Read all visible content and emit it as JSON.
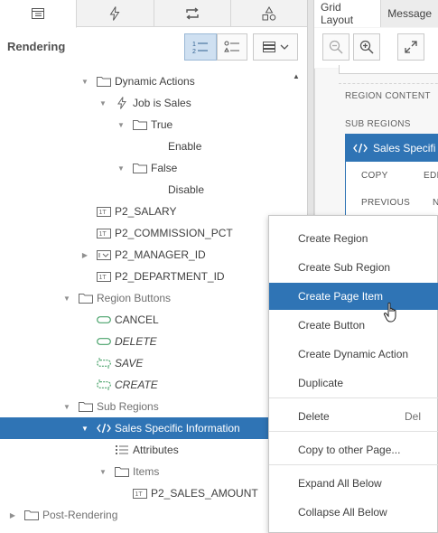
{
  "left_panel": {
    "tabs": [
      {
        "name": "tab-rendering",
        "icon": "tree-icon"
      },
      {
        "name": "tab-dynamic-actions",
        "icon": "lightning-icon"
      },
      {
        "name": "tab-processing",
        "icon": "loop-icon"
      },
      {
        "name": "tab-shared-components",
        "icon": "shapes-icon"
      }
    ],
    "title": "Rendering",
    "tree": [
      {
        "label": "Dynamic Actions",
        "icon": "folder-icon",
        "toggle": "open",
        "indent": 4
      },
      {
        "label": "Job is Sales",
        "icon": "lightning-icon",
        "toggle": "open",
        "indent": 5
      },
      {
        "label": "True",
        "icon": "folder-icon",
        "toggle": "open",
        "indent": 6
      },
      {
        "label": "Enable",
        "icon": "",
        "toggle": "",
        "indent": 8
      },
      {
        "label": "False",
        "icon": "folder-icon",
        "toggle": "open",
        "indent": 6
      },
      {
        "label": "Disable",
        "icon": "",
        "toggle": "",
        "indent": 8
      },
      {
        "label": "P2_SALARY",
        "icon": "text-field-icon",
        "toggle": "",
        "indent": 4
      },
      {
        "label": "P2_COMMISSION_PCT",
        "icon": "text-field-icon",
        "toggle": "",
        "indent": 4
      },
      {
        "label": "P2_MANAGER_ID",
        "icon": "select-list-icon",
        "toggle": "closed",
        "indent": 4
      },
      {
        "label": "P2_DEPARTMENT_ID",
        "icon": "text-field-icon",
        "toggle": "",
        "indent": 4
      },
      {
        "label": "Region Buttons",
        "icon": "folder-icon",
        "toggle": "open",
        "indent": 3,
        "gray": true
      },
      {
        "label": "CANCEL",
        "icon": "button-icon",
        "toggle": "",
        "indent": 4
      },
      {
        "label": "DELETE",
        "icon": "button-icon",
        "toggle": "",
        "indent": 4,
        "italic": true
      },
      {
        "label": "SAVE",
        "icon": "button-conditional-icon",
        "toggle": "",
        "indent": 4,
        "italic": true
      },
      {
        "label": "CREATE",
        "icon": "button-conditional-icon",
        "toggle": "",
        "indent": 4,
        "italic": true
      },
      {
        "label": "Sub Regions",
        "icon": "folder-icon",
        "toggle": "open",
        "indent": 3,
        "gray": true
      },
      {
        "label": "Sales Specific Information",
        "icon": "code-icon",
        "toggle": "open",
        "indent": 4,
        "selected": true
      },
      {
        "label": "Attributes",
        "icon": "list-icon",
        "toggle": "",
        "indent": 5
      },
      {
        "label": "Items",
        "icon": "folder-icon",
        "toggle": "open",
        "indent": 5,
        "gray": true
      },
      {
        "label": "P2_SALES_AMOUNT",
        "icon": "text-field-icon",
        "toggle": "",
        "indent": 6
      },
      {
        "label": "Post-Rendering",
        "icon": "folder-icon",
        "toggle": "closed",
        "indent": 0,
        "gray": true
      }
    ]
  },
  "right_panel": {
    "tabs": [
      "Grid Layout",
      "Message"
    ],
    "labels": {
      "region_content": "REGION CONTENT",
      "sub_regions": "SUB REGIONS",
      "sub_region_title": "Sales Specifi",
      "copy": "COPY",
      "edit": "EDI",
      "previous": "PREVIOUS",
      "next": "N"
    }
  },
  "context_menu": {
    "items": [
      {
        "label": "Create Region",
        "shortcut": ""
      },
      {
        "label": "Create Sub Region",
        "shortcut": ""
      },
      {
        "label": "Create Page Item",
        "shortcut": "",
        "highlighted": true
      },
      {
        "label": "Create Button",
        "shortcut": ""
      },
      {
        "label": "Create Dynamic Action",
        "shortcut": ""
      },
      {
        "label": "Duplicate",
        "shortcut": ""
      },
      {
        "label": "Delete",
        "shortcut": "Del"
      },
      {
        "label": "Copy to other Page...",
        "shortcut": ""
      },
      {
        "label": "Expand All Below",
        "shortcut": ""
      },
      {
        "label": "Collapse All Below",
        "shortcut": ""
      }
    ]
  },
  "colors": {
    "accent": "#2f74b5",
    "button_green": "#4aa36b"
  }
}
